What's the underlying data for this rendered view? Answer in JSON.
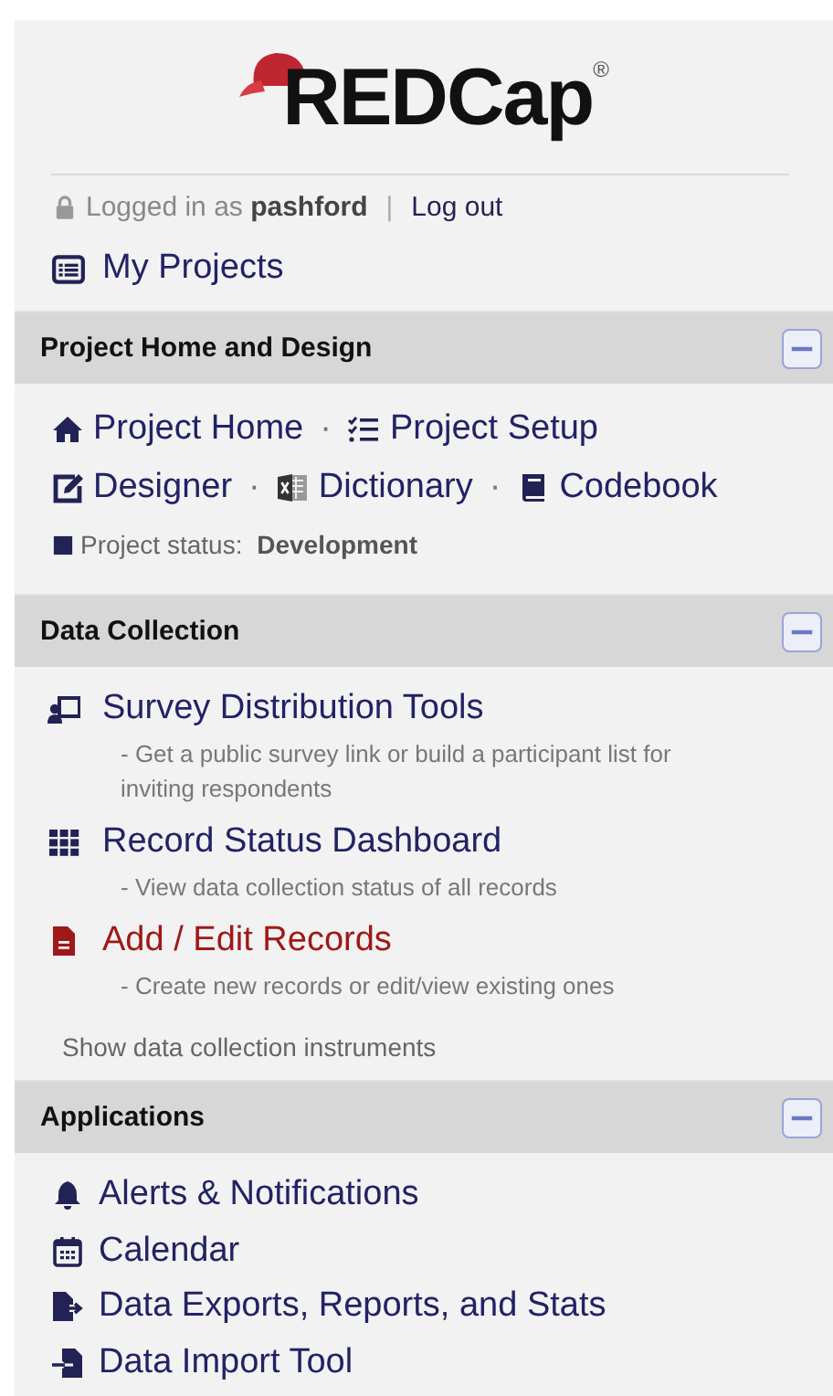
{
  "logo": {
    "text": "REDCap",
    "mark": "®"
  },
  "login": {
    "prefix": "Logged in as",
    "user": "pashford",
    "separator": "|",
    "logout": "Log out"
  },
  "my_projects": "My Projects",
  "sections": [
    {
      "title": "Project Home and Design",
      "expanded": true,
      "kind": "inline",
      "rows": [
        {
          "items": [
            {
              "kind": "link",
              "label": "Project Home"
            },
            {
              "kind": "dot",
              "text": "·"
            },
            {
              "kind": "link",
              "label": "Project Setup"
            }
          ]
        },
        {
          "items": [
            {
              "kind": "link",
              "label": "Designer"
            },
            {
              "kind": "dot",
              "text": "·"
            },
            {
              "kind": "link",
              "label": "Dictionary"
            },
            {
              "kind": "dot",
              "text": "·"
            },
            {
              "kind": "link",
              "label": "Codebook"
            }
          ]
        }
      ],
      "status": {
        "label": "Project status:",
        "value": "Development"
      }
    },
    {
      "title": "Data Collection",
      "expanded": true,
      "kind": "described",
      "items": [
        {
          "label": "Survey Distribution Tools",
          "description": "- Get a public survey link or build a participant list for inviting respondents",
          "selected": false
        },
        {
          "label": "Record Status Dashboard",
          "description": "- View data collection status of all records",
          "selected": false
        },
        {
          "label": "Add / Edit Records",
          "description": "- Create new records or edit/view existing ones",
          "selected": true
        }
      ],
      "footer": "Show data collection instruments"
    },
    {
      "title": "Applications",
      "expanded": true,
      "kind": "list",
      "items": [
        {
          "label": "Alerts & Notifications"
        },
        {
          "label": "Calendar"
        },
        {
          "label": "Data Exports, Reports, and Stats"
        },
        {
          "label": "Data Import Tool"
        }
      ]
    }
  ]
}
